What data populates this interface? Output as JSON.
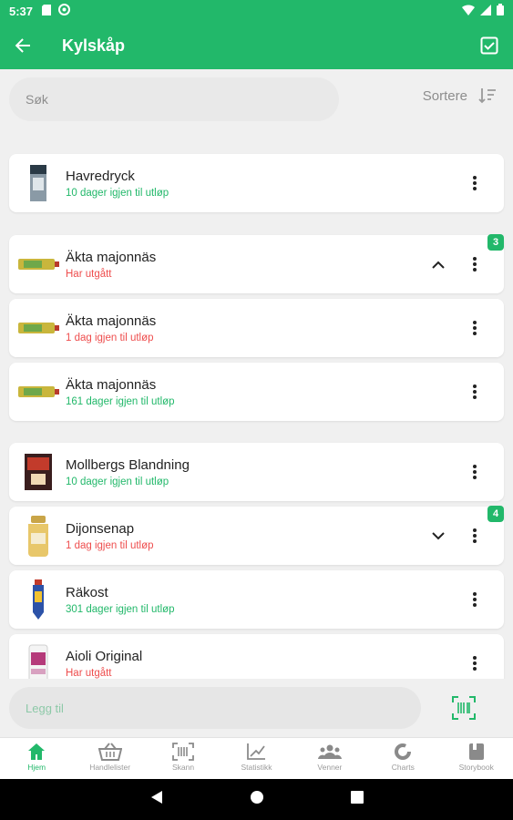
{
  "statusbar": {
    "time": "5:37"
  },
  "appbar": {
    "title": "Kylskåp"
  },
  "search": {
    "placeholder": "Søk",
    "sort_label": "Sortere"
  },
  "items": [
    {
      "name": "Havredryck",
      "status": "10 dager igjen til utløp",
      "status_type": "green"
    },
    {
      "name": "Äkta majonnäs",
      "status": "Har utgått",
      "status_type": "red",
      "badge": "3",
      "expanded": true
    },
    {
      "name": "Äkta majonnäs",
      "status": "1 dag igjen til utløp",
      "status_type": "red"
    },
    {
      "name": "Äkta majonnäs",
      "status": "161 dager igjen til utløp",
      "status_type": "green"
    },
    {
      "name": "Mollbergs Blandning",
      "status": "10 dager igjen til utløp",
      "status_type": "green"
    },
    {
      "name": "Dijonsenap",
      "status": "1 dag igjen til utløp",
      "status_type": "red",
      "badge": "4",
      "expanded": false
    },
    {
      "name": "Räkost",
      "status": "301 dager igjen til utløp",
      "status_type": "green"
    },
    {
      "name": "Aioli Original",
      "status": "Har utgått",
      "status_type": "red"
    }
  ],
  "add": {
    "placeholder": "Legg til"
  },
  "nav": [
    {
      "label": "Hjem",
      "icon": "home-icon",
      "active": true
    },
    {
      "label": "Handlelister",
      "icon": "basket-icon"
    },
    {
      "label": "Skann",
      "icon": "barcode-icon"
    },
    {
      "label": "Statistikk",
      "icon": "chart-icon"
    },
    {
      "label": "Venner",
      "icon": "people-icon"
    },
    {
      "label": "Charts",
      "icon": "donut-icon"
    },
    {
      "label": "Storybook",
      "icon": "book-icon"
    }
  ],
  "colors": {
    "primary": "#22b86a",
    "expired": "#ee4d4d"
  }
}
